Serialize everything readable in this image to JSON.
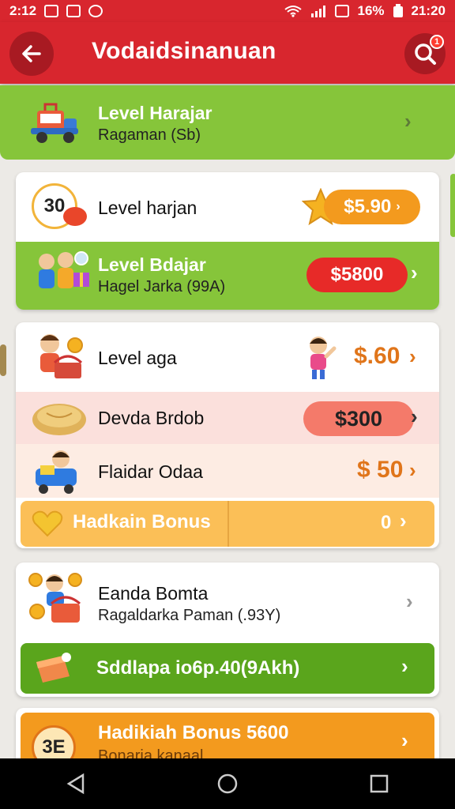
{
  "status_bar": {
    "time_left": "2:12",
    "battery": "16%",
    "time_right": "21:20"
  },
  "app_bar": {
    "title": "Vodaidsinanuan",
    "notification_count": "1"
  },
  "top_banner": {
    "title": "Level Harajar",
    "subtitle": "Ragaman (Sb)"
  },
  "card1": {
    "row1": {
      "badge": "30",
      "title": "Level harjan",
      "amount": "$5.90"
    },
    "row2": {
      "title": "Level Bdajar",
      "subtitle": "Hagel Jarka (99A)",
      "amount": "$5800"
    }
  },
  "card2": {
    "row1": {
      "title": "Level aga",
      "amount": "$.60"
    },
    "row2": {
      "title": "Devda Brdob",
      "amount": "$300"
    },
    "row3": {
      "title": "Flaidar Odaa",
      "amount": "$ 50"
    },
    "bonus": {
      "title": "Hadkain Bonus",
      "value": "0"
    }
  },
  "card3": {
    "title": "Eanda Bomta",
    "subtitle": "Ragaldarka Paman (.93Y)",
    "action_label": "Sddlapa io6p.40(9Akh)"
  },
  "bottom_banner": {
    "badge": "3E",
    "title": "Hadikiah Bonus 5600",
    "subtitle": "Bonaria kanaal"
  },
  "colors": {
    "brand_red": "#d8262e",
    "green": "#86c53a",
    "dark_green": "#5aa51c",
    "orange": "#f39a1e",
    "amount_orange": "#e0751a"
  }
}
